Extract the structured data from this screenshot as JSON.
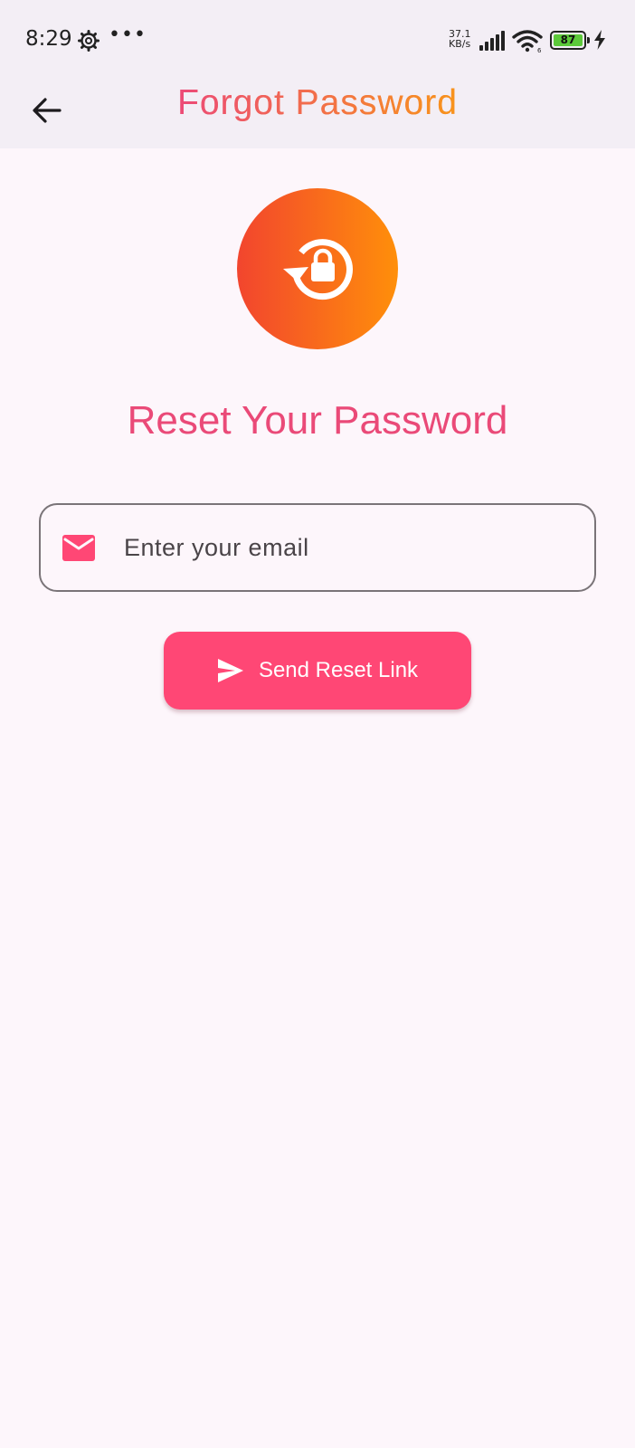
{
  "status_bar": {
    "time": "8:29",
    "dots": "•••",
    "network_speed_value": "37.1",
    "network_speed_unit": "KB/s",
    "battery_level": "87",
    "icons": [
      "settings-gear-icon",
      "signal-icon",
      "wifi-icon",
      "battery-icon",
      "charging-bolt-icon"
    ]
  },
  "app_bar": {
    "title": "Forgot Password",
    "back_icon": "arrow-left-icon"
  },
  "main": {
    "logo_icon": "lock-reset-icon",
    "heading": "Reset Your Password",
    "email_field": {
      "placeholder": "Enter your email",
      "value": "",
      "icon": "mail-icon"
    },
    "send_button": {
      "label": "Send Reset Link",
      "icon": "send-icon"
    }
  },
  "colors": {
    "accent_pink": "#ff4775",
    "heading_pink": "#ea4a78",
    "gradient_start": "#f2452e",
    "gradient_end": "#ff8f0a",
    "background": "#fdf6fb",
    "bar_background": "#f3eef5"
  }
}
